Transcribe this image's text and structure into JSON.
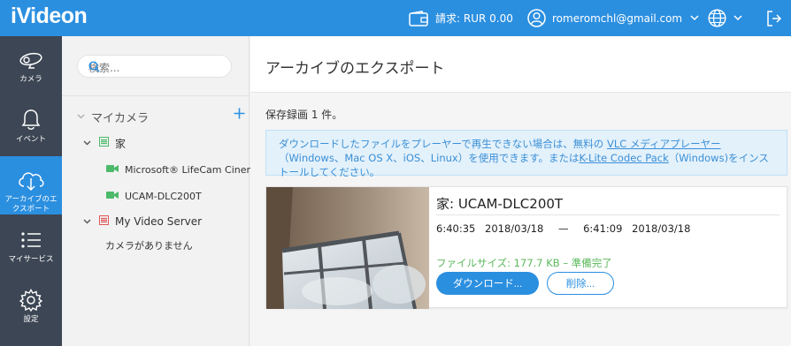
{
  "app": {
    "logo": "iVideon"
  },
  "topbar": {
    "balance": "請求: RUR 0.00",
    "user_email": "romeromchl@gmail.com"
  },
  "sidebar": {
    "items": [
      {
        "label": "カメラ",
        "icon": "camera-icon",
        "active": false
      },
      {
        "label": "イベント",
        "icon": "bell-icon",
        "active": false
      },
      {
        "label": "アーカイブのエクスポート",
        "icon": "cloud-download-icon",
        "active": true
      },
      {
        "label": "マイサービス",
        "icon": "list-icon",
        "active": false
      },
      {
        "label": "設定",
        "icon": "gear-icon",
        "active": false
      }
    ]
  },
  "panel": {
    "search_placeholder": "検索...",
    "my_cameras": "マイカメラ",
    "tree": [
      {
        "label": "家",
        "color": "#4cba6a",
        "cameras": [
          "Microsoft® LifeCam Cinema",
          "UCAM-DLC200T"
        ]
      },
      {
        "label": "My Video Server",
        "color": "#e05a5a",
        "empty_text": "カメラがありません"
      }
    ]
  },
  "main": {
    "title": "アーカイブのエクスポート",
    "count": "保存録画 1 件。",
    "info": {
      "text1": "ダウンロードしたファイルをプレーヤーで再生できない場合は、無料の ",
      "link1": "VLC メディアプレーヤー",
      "text2": "（Windows、Mac OS X、iOS、Linux）を使用できます。または",
      "link2": "K-Lite Codec Pack",
      "text3": "（Windows)をインストールしてください。"
    },
    "card": {
      "title": "家: UCAM-DLC200T",
      "start_time": "6:40:35",
      "start_date": "2018/03/18",
      "dash": "—",
      "end_time": "6:41:09",
      "end_date": "2018/03/18",
      "size": "ファイルサイズ: 177.7 KB – 準備完了",
      "download_label": "ダウンロード...",
      "delete_label": "削除..."
    }
  },
  "colors": {
    "accent": "#2b8fe0",
    "sidebar_bg": "#3d4654",
    "ready": "#5cb85c"
  }
}
